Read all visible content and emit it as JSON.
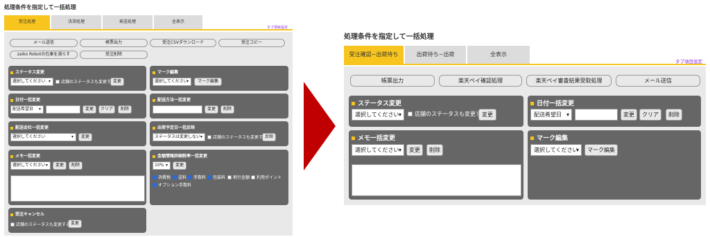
{
  "left": {
    "title": "処理条件を指定して一括処理",
    "tabs": [
      "受注処理",
      "決済処理",
      "発送処理",
      "全表示"
    ],
    "tab_settings": "タブ項目設定",
    "action_buttons": [
      "メール送信",
      "帳票出力",
      "受注CSVダウンロード",
      "受注コピー",
      "zaiko Robotの在庫を減らす",
      "受注削除"
    ],
    "status_panel": {
      "title": "ステータス変更",
      "select": "選択してください",
      "checkbox": "店舗のステータスも変更する",
      "button": "変更"
    },
    "mark_panel": {
      "title": "マーク編集",
      "select": "選択してください",
      "button": "マーク編集"
    },
    "date_panel": {
      "title": "日付一括変更",
      "select": "配送希望日",
      "change": "変更",
      "clear": "クリア",
      "delete": "削除"
    },
    "delivery_method_panel": {
      "title": "配送方法一括変更",
      "change": "変更",
      "delete": "削除"
    },
    "delivery_company_panel": {
      "title": "配送会社一括変更",
      "select": "選択してください",
      "button": "変更"
    },
    "ship_date_panel": {
      "title": "出荷予定日一括反映",
      "select": "ステータスは変更しない",
      "checkbox": "店舗のステータスも変更する",
      "button": "反映"
    },
    "memo_panel": {
      "title": "メモ一括変更",
      "select": "選択してください",
      "change": "変更",
      "delete": "削除"
    },
    "tax_panel": {
      "title": "金額情報詳細税率一括変更",
      "select": "10%",
      "button": "変更",
      "checks": [
        "消費税",
        "送料",
        "手数料",
        "包装料",
        "割引金額",
        "利用ポイント",
        "オプション手数料"
      ],
      "checks_state": [
        true,
        true,
        true,
        true,
        false,
        false,
        true
      ]
    },
    "cancel_panel": {
      "title": "受注キャンセル",
      "checkbox": "店舗のステータスも変更する",
      "button": "変更"
    }
  },
  "right": {
    "title": "処理条件を指定して一括処理",
    "tabs": [
      "受注確認~出荷待ち",
      "出荷待ち~出荷",
      "全表示"
    ],
    "tab_settings": "タブ項目設定",
    "action_buttons": [
      "帳票出力",
      "楽天ペイ確認処理",
      "楽天ペイ審査結果受取処理",
      "メール送信"
    ],
    "status_panel": {
      "title": "ステータス変更",
      "select": "選択してください",
      "checkbox": "店舗のステータスも変更する",
      "button": "変更"
    },
    "date_panel": {
      "title": "日付一括変更",
      "select": "配送希望日",
      "change": "変更",
      "clear": "クリア",
      "delete": "削除"
    },
    "memo_panel": {
      "title": "メモ一括変更",
      "select": "選択してください",
      "change": "変更",
      "delete": "削除"
    },
    "mark_panel": {
      "title": "マーク編集",
      "select": "選択してください",
      "button": "マーク編集"
    }
  },
  "colors": {
    "accent": "#f7c51e",
    "panel": "#666666",
    "arrow": "#c00000",
    "tab_settings": "#8a2be2"
  }
}
